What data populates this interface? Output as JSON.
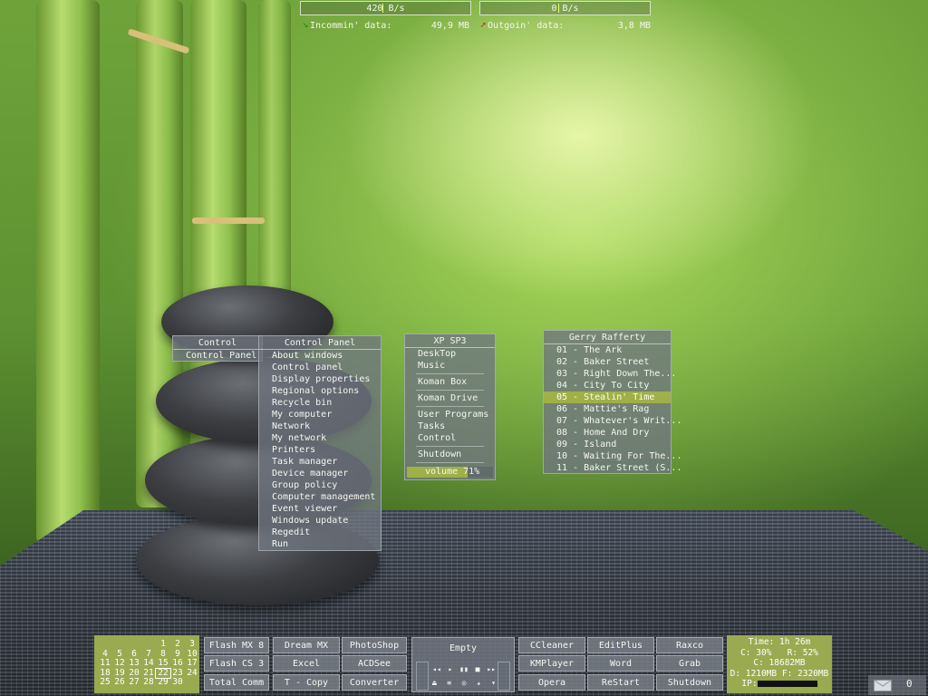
{
  "network": {
    "in_rate": "420 B/s",
    "out_rate": "0 B/s",
    "in_level": 0.48,
    "out_level": 0.46,
    "in_label": "Incommin' data:",
    "in_total": "49,9 MB",
    "out_label": "Outgoin' data:",
    "out_total": "3,8 MB",
    "icons": {
      "in": "arrow-down-icon",
      "out": "arrow-up-icon"
    }
  },
  "control_menu": {
    "title": "Control",
    "item": "Control Panel"
  },
  "control_panel_menu": {
    "title": "Control Panel",
    "items": [
      "About windows",
      "Control panel",
      "Display properties",
      "Regional options",
      "Recycle bin",
      "My computer",
      "Network",
      "My network",
      "Printers",
      "Task manager",
      "Device manager",
      "Group policy",
      "Computer management",
      "Event viewer",
      "Windows update",
      "Regedit",
      "Run"
    ]
  },
  "xp_menu": {
    "title": "XP SP3",
    "items": [
      "DeskTop",
      "Music",
      "Koman Box",
      "Koman Drive",
      "User Programs",
      "Tasks",
      "Control",
      "Shutdown"
    ],
    "volume": "volume 71%",
    "volume_level": 0.71
  },
  "playlist": {
    "title": "Gerry Rafferty",
    "tracks": [
      "01 - The Ark",
      "02 - Baker Street",
      "03 - Right Down The...",
      "04 - City To City",
      "05 - Stealin' Time",
      "06 - Mattie's Rag",
      "07 - Whatever's Writ...",
      "08 - Home And Dry",
      "09 - Island",
      "10 - Waiting For The...",
      "11 - Baker Street (S..."
    ],
    "selected_index": 4
  },
  "calendar": {
    "days": [
      "",
      "",
      "",
      "",
      "1",
      "2",
      "3",
      "4",
      "5",
      "6",
      "7",
      "8",
      "9",
      "10",
      "11",
      "12",
      "13",
      "14",
      "15",
      "16",
      "17",
      "18",
      "19",
      "20",
      "21",
      "22",
      "23",
      "24",
      "25",
      "26",
      "27",
      "28",
      "29",
      "30"
    ],
    "today": "22"
  },
  "launchers": {
    "col1": [
      "Flash MX 8",
      "Flash CS 3",
      "Total Comm"
    ],
    "col2": [
      "Dream MX",
      "Excel",
      "T - Copy"
    ],
    "col3": [
      "PhotoShop",
      "ACDSee",
      "Converter"
    ],
    "col4": [
      "CCleaner",
      "KMPlayer",
      "Opera"
    ],
    "col5": [
      "EditPlus",
      "Word",
      "ReStart"
    ],
    "col6": [
      "Raxco",
      "Grab",
      "Shutdown"
    ]
  },
  "player": {
    "title": "Empty",
    "row1": [
      "◂◂",
      "▸",
      "▮▮",
      "■",
      "▸▸"
    ],
    "row2": [
      "⏏",
      "≡",
      "◎",
      "▴",
      "▾"
    ]
  },
  "stats": {
    "time": "Time: 1h 26m",
    "cpu": "C: 30%",
    "ram": "R: 52%",
    "drive_c": "C: 18682MB",
    "drive_d": "D: 1210MB",
    "drive_f": "F: 2320MB",
    "ip_label": "IP:"
  },
  "mail": {
    "count": "0",
    "icon": "envelope-icon"
  }
}
